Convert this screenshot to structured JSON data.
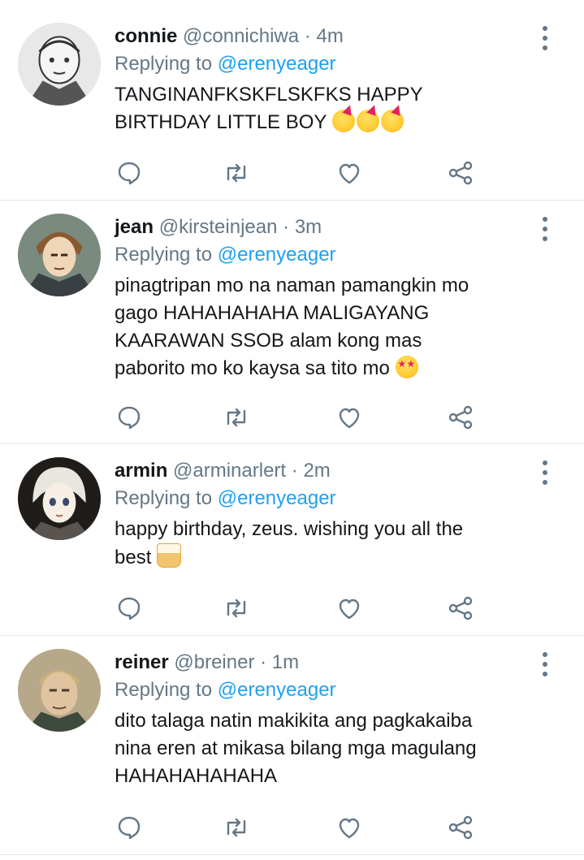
{
  "replies": [
    {
      "name": "connie",
      "handle": "@connichiwa",
      "separator": "·",
      "time": "4m",
      "replying_prefix": "Replying to",
      "replying_to": "@erenyeager",
      "text_lines": [
        "TANGINANFKSKFLSKFKS HAPPY",
        "BIRTHDAY LITTLE BOY"
      ],
      "emoji": [
        "partying-face-emoji",
        "partying-face-emoji",
        "partying-face-emoji"
      ],
      "avatar_icon": "connie-avatar"
    },
    {
      "name": "jean",
      "handle": "@kirsteinjean",
      "separator": "·",
      "time": "3m",
      "replying_prefix": "Replying to",
      "replying_to": "@erenyeager",
      "text_lines": [
        "pinagtripan mo na naman pamangkin mo",
        "gago HAHAHAHAHA MALIGAYANG",
        "KAARAWAN SSOB alam kong mas",
        "paborito mo ko kaysa sa tito mo"
      ],
      "emoji": [
        "star-struck-emoji"
      ],
      "avatar_icon": "jean-avatar"
    },
    {
      "name": "armin",
      "handle": "@arminarlert",
      "separator": "·",
      "time": "2m",
      "replying_prefix": "Replying to",
      "replying_to": "@erenyeager",
      "text_lines": [
        "happy birthday, zeus. wishing you all the",
        "best"
      ],
      "emoji": [
        "birthday-cake-emoji"
      ],
      "avatar_icon": "armin-avatar"
    },
    {
      "name": "reiner",
      "handle": "@breiner",
      "separator": "·",
      "time": "1m",
      "replying_prefix": "Replying to",
      "replying_to": "@erenyeager",
      "text_lines": [
        "dito talaga natin makikita ang pagkakaiba",
        "nina eren at mikasa bilang mga magulang",
        "HAHAHAHAHAHA"
      ],
      "emoji": [],
      "avatar_icon": "reiner-avatar"
    }
  ],
  "action_icons": [
    "reply-icon",
    "retweet-icon",
    "like-icon",
    "share-icon"
  ],
  "colors": {
    "link": "#1da1f2",
    "secondary_text": "#657786",
    "primary_text": "#14171a",
    "divider": "#e1e8ed"
  }
}
